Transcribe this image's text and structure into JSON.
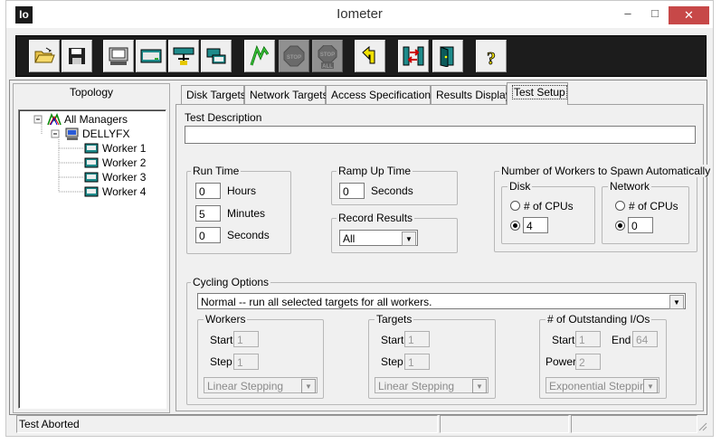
{
  "window": {
    "title": "Iometer",
    "app_icon_text": "Io"
  },
  "toolbar": {
    "buttons": [
      {
        "name": "open-config",
        "icon": "folder-open-icon"
      },
      {
        "name": "save-config",
        "icon": "floppy-disk-icon"
      },
      {
        "name": "show-results",
        "icon": "computer-display-icon"
      },
      {
        "name": "new-disk-worker",
        "icon": "disk-worker-icon"
      },
      {
        "name": "new-network-worker",
        "icon": "network-worker-icon"
      },
      {
        "name": "duplicate-worker",
        "icon": "duplicate-worker-icon"
      },
      {
        "name": "start-tests",
        "icon": "green-flag-icon"
      },
      {
        "name": "stop-test",
        "icon": "stop-sign-icon",
        "text": "STOP"
      },
      {
        "name": "stop-all",
        "icon": "stop-all-icon",
        "text": "STOP ALL"
      },
      {
        "name": "reset-workers",
        "icon": "reset-arrow-icon"
      },
      {
        "name": "start-new-manager",
        "icon": "manager-icon"
      },
      {
        "name": "exit",
        "icon": "exit-door-icon"
      },
      {
        "name": "about",
        "icon": "question-mark-icon",
        "text": "?"
      }
    ]
  },
  "topology": {
    "label": "Topology",
    "root": "All Managers",
    "manager": "DELLYFX",
    "workers": [
      "Worker 1",
      "Worker 2",
      "Worker 3",
      "Worker 4"
    ]
  },
  "tabs": [
    "Disk Targets",
    "Network Targets",
    "Access Specifications",
    "Results Display",
    "Test Setup"
  ],
  "active_tab": "Test Setup",
  "test_setup": {
    "description_label": "Test Description",
    "description_value": "",
    "run_time": {
      "label": "Run Time",
      "hours": "0",
      "hours_label": "Hours",
      "minutes": "5",
      "minutes_label": "Minutes",
      "seconds": "0",
      "seconds_label": "Seconds"
    },
    "ramp_up": {
      "label": "Ramp Up Time",
      "value": "0",
      "unit": "Seconds"
    },
    "record_results": {
      "label": "Record Results",
      "value": "All"
    },
    "spawn": {
      "label": "Number of Workers to Spawn Automatically",
      "disk": {
        "label": "Disk",
        "cpus_label": "# of CPUs",
        "value": "4"
      },
      "network": {
        "label": "Network",
        "cpus_label": "# of CPUs",
        "value": "0"
      }
    },
    "cycling": {
      "label": "Cycling Options",
      "mode": "Normal -- run all selected targets for all workers.",
      "workers": {
        "label": "Workers",
        "start_label": "Start",
        "start": "1",
        "step_label": "Step",
        "step": "1",
        "stepping": "Linear Stepping"
      },
      "targets": {
        "label": "Targets",
        "start_label": "Start",
        "start": "1",
        "step_label": "Step",
        "step": "1",
        "stepping": "Linear Stepping"
      },
      "ios": {
        "label": "# of Outstanding I/Os",
        "start_label": "Start",
        "start": "1",
        "end_label": "End",
        "end": "64",
        "power_label": "Power",
        "power": "2",
        "stepping": "Exponential Stepping"
      }
    }
  },
  "status_bar": {
    "text": "Test Aborted"
  }
}
